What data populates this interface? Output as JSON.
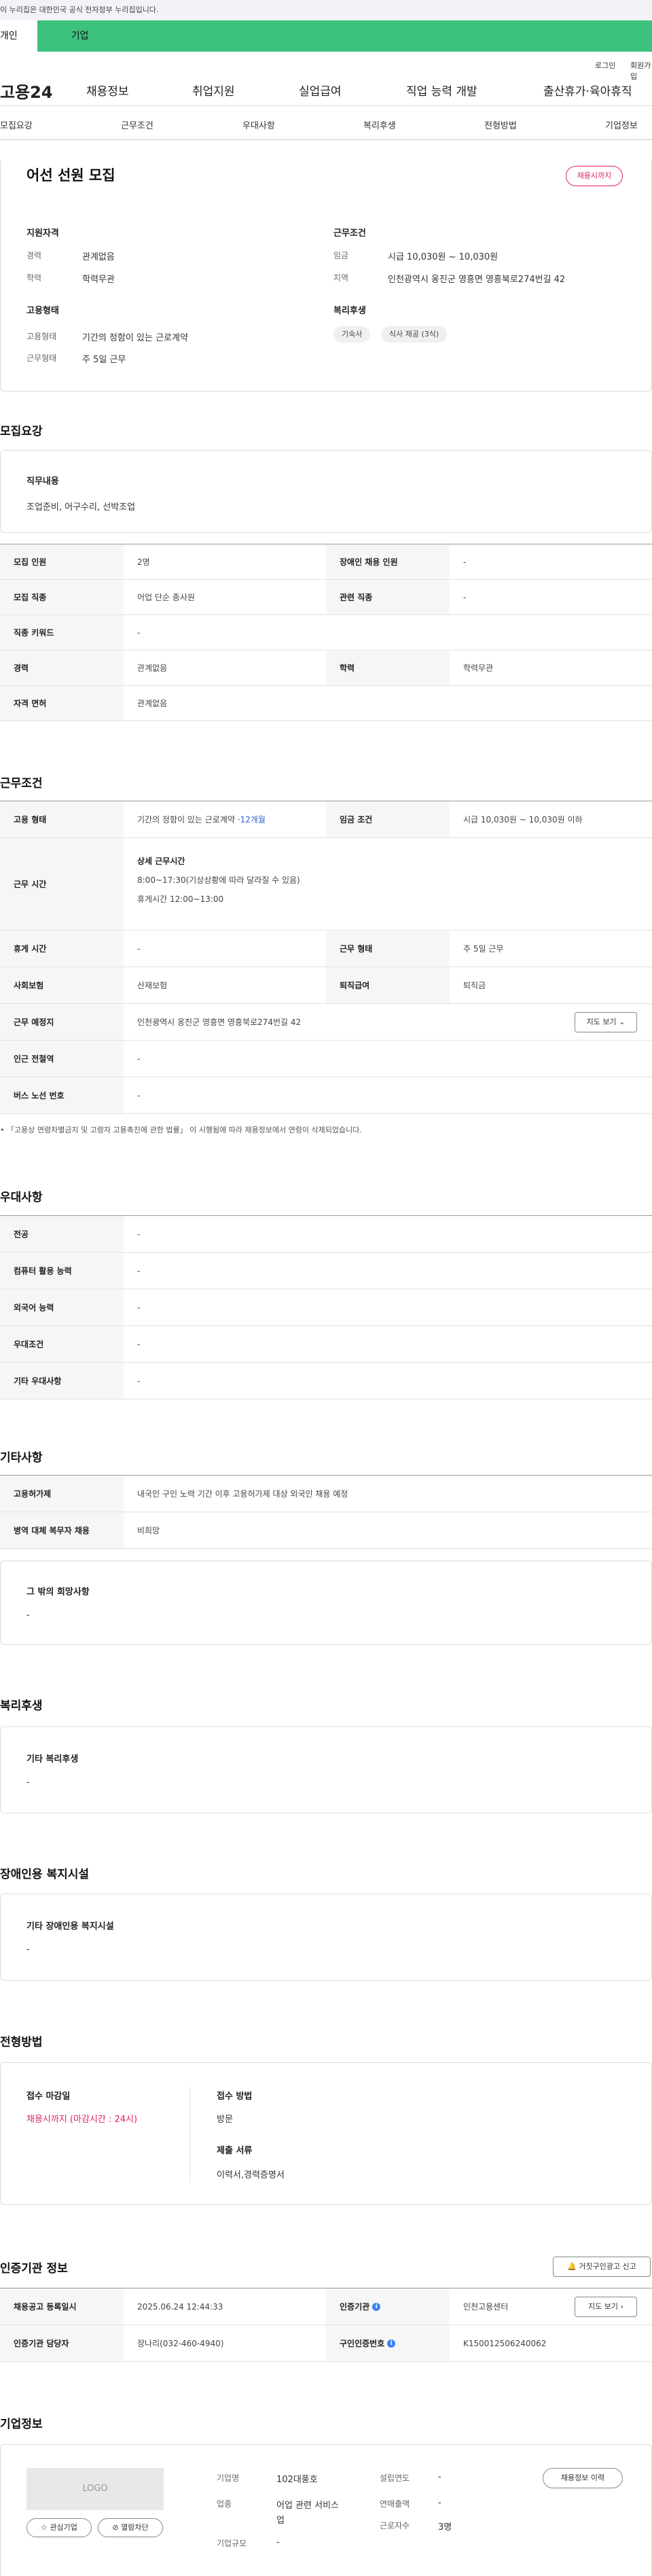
{
  "gov_banner": "이 누리집은 대한민국 공식 전자정부 누리집입니다.",
  "user_tabs": {
    "personal": "개인",
    "enterprise": "기업"
  },
  "util": {
    "login": "로그인",
    "join": "회원가입"
  },
  "gnb": {
    "logo": "고용24",
    "menu": [
      "채용정보",
      "취업지원",
      "실업급여",
      "직업 능력 개발",
      "출산휴가·육아휴직"
    ]
  },
  "lnb": [
    "모집요강",
    "근무조건",
    "우대사항",
    "복리후생",
    "전형방법",
    "기업정보"
  ],
  "summary": {
    "title": "어선 선원 모집",
    "status_badge": "채용시까지",
    "qual_title": "지원자격",
    "career_label": "경력",
    "career_value": "관계없음",
    "edu_label": "학력",
    "edu_value": "학력무관",
    "emp_title": "고용형태",
    "emptype_label": "고용형태",
    "emptype_value": "기간의 정함이 있는 근로계약",
    "worktype_label": "근무형태",
    "worktype_value": "주 5일 근무",
    "cond_title": "근무조건",
    "wage_label": "임금",
    "wage_value": "시급 10,030원 ~ 10,030원",
    "region_label": "지역",
    "region_value": "인천광역시 옹진군 영흥면 영흥북로274번길 42",
    "welfare_title": "복리후생",
    "welfare_chips": [
      "기숙사",
      "식사 제공 (3식)"
    ]
  },
  "recruit": {
    "section_title": "모집요강",
    "duty_title": "직무내용",
    "duty_value": "조업준비, 어구수리, 선박조업",
    "rows": [
      {
        "th": "모집 인원",
        "td": "2명",
        "th2": "장애인 채용 인원",
        "td2": "-"
      },
      {
        "th": "모집 직종",
        "td": "어업 단순 종사원",
        "th2": "관련 직종",
        "td2": "-"
      },
      {
        "th": "직종 키워드",
        "td": "-"
      },
      {
        "th": "경력",
        "td": "관계없음",
        "th2": "학력",
        "td2": "학력무관"
      },
      {
        "th": "자격 면허",
        "td": "관계없음"
      }
    ]
  },
  "work": {
    "section_title": "근무조건",
    "emp_type_th": "고용 형태",
    "emp_type_td": "기간의 정함이 있는 근로계약 · ",
    "emp_type_months": "12개월",
    "wage_th": "임금 조건",
    "wage_td": "시급 10,030원 ~ 10,030원 이하",
    "hours_th": "근무 시간",
    "hours_title": "상세 근무시간",
    "hours_line1": "8:00~17:30(기상상황에 따라 달라질 수 있음)",
    "hours_line2": "휴게시간 12:00~13:00",
    "rest_th": "휴게 시간",
    "rest_td": "-",
    "worktype_th": "근무 형태",
    "worktype_td": "주 5일 근무",
    "insure_th": "사회보험",
    "insure_td": "산재보험",
    "retire_th": "퇴직급여",
    "retire_td": "퇴직금",
    "place_th": "근무 예정지",
    "place_td": "인천광역시 옹진군 영흥면 영흥북로274번길 42",
    "map_btn": "지도 보기",
    "subway_th": "인근 전철역",
    "subway_td": "-",
    "bus_th": "버스 노선 번호",
    "bus_td": "-",
    "note": "「고용상 연령차별금지 및 고령자 고용촉진에 관한 법률」 이 시행됨에 따라 채용정보에서 연령이 삭제되었습니다."
  },
  "pref": {
    "section_title": "우대사항",
    "rows": [
      {
        "th": "전공",
        "td": "-"
      },
      {
        "th": "컴퓨터 활용 능력",
        "td": "-"
      },
      {
        "th": "외국어 능력",
        "td": "-"
      },
      {
        "th": "우대조건",
        "td": "-"
      },
      {
        "th": "기타 우대사항",
        "td": "-"
      }
    ]
  },
  "etc": {
    "section_title": "기타사항",
    "rows": [
      {
        "th": "고용허가제",
        "td": "내국인 구인 노력 기간 이후 고용허가제 대상 외국인 채용 예정"
      },
      {
        "th": "병역 대체 복무자 채용",
        "td": "비희망"
      }
    ],
    "hope_title": "그 밖의 희망사항",
    "hope_value": "-"
  },
  "welfare": {
    "section_title": "복리후생",
    "box_title": "기타 복리후생",
    "box_value": "-"
  },
  "disabled": {
    "section_title": "장애인용 복지시설",
    "box_title": "기타 장애인용 복지시설",
    "box_value": "-"
  },
  "selection": {
    "section_title": "전형방법",
    "deadline_title": "접수 마감일",
    "deadline_value": "채용시까지 (마감시간 : 24시)",
    "method_title": "접수 방법",
    "method_value": "방문",
    "docs_title": "제출 서류",
    "docs_value": "이력서,경력증명서"
  },
  "cert": {
    "section_title": "인증기관 정보",
    "report_btn": "거짓구인광고 신고",
    "reg_th": "채용공고 등록일시",
    "reg_td": "2025.06.24 12:44:33",
    "org_th": "인증기관",
    "org_td": "인천고용센터",
    "map_btn": "지도 보기",
    "staff_th": "인증기관 담당자",
    "staff_td": "장나리(032-460-4940)",
    "no_th": "구인인증번호",
    "no_td": "K150012506240062"
  },
  "company": {
    "section_title": "기업정보",
    "logo_text": "LOGO",
    "fav_btn": "관심기업",
    "block_btn": "열람차단",
    "history_btn": "채용정보 이력",
    "name_label": "기업명",
    "name_value": "102대풍호",
    "industry_label": "업종",
    "industry_value1": "어업 관련 서비스",
    "industry_value2": "업",
    "size_label": "기업규모",
    "size_value": "-",
    "year_label": "설립연도",
    "year_value": "-",
    "sales_label": "연매출액",
    "sales_value": "-",
    "staff_label": "근로자수",
    "staff_value": "3명"
  }
}
